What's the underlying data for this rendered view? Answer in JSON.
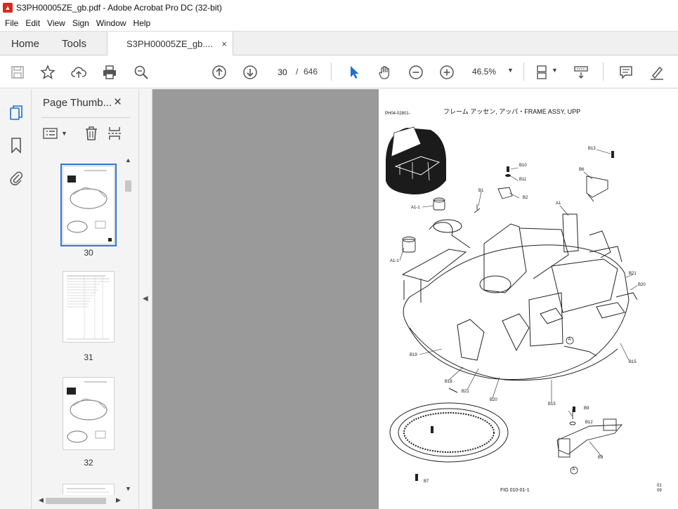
{
  "window": {
    "title": "S3PH00005ZE_gb.pdf - Adobe Acrobat Pro DC (32-bit)"
  },
  "menu": [
    "File",
    "Edit",
    "View",
    "Sign",
    "Window",
    "Help"
  ],
  "tabs": {
    "home": "Home",
    "tools": "Tools",
    "document": "S3PH00005ZE_gb....",
    "close_glyph": "×"
  },
  "toolbar": {
    "current_page": "30",
    "page_separator": "/",
    "total_pages": "646",
    "zoom": "46.5%"
  },
  "panel": {
    "title": "Page Thumb...",
    "close_glyph": "×"
  },
  "thumbnails": [
    {
      "label": "30",
      "selected": true
    },
    {
      "label": "31",
      "selected": false
    },
    {
      "label": "32",
      "selected": false
    }
  ],
  "document_page": {
    "ref_code": "PH04-02801-",
    "title": "フレーム アッセン, アッパ・FRAME ASSY, UPP",
    "fig_label": "FIG 010-01-1",
    "page_no_top": "01",
    "page_no_bottom": "09",
    "callouts": [
      "B13",
      "B6",
      "B10",
      "B11",
      "B1",
      "B2",
      "A1-1",
      "A1",
      "A1-1",
      "B21",
      "B20",
      "B19",
      "B18",
      "B21",
      "B20",
      "B15",
      "B15",
      "B9",
      "B12",
      "B3",
      "B7",
      "A",
      "A"
    ]
  }
}
